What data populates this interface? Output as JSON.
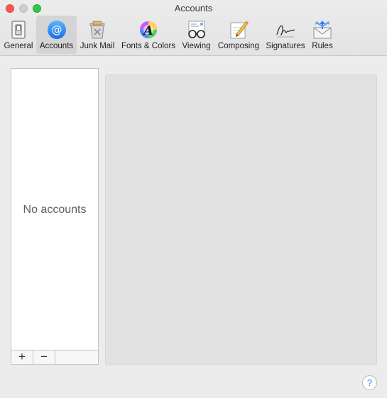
{
  "window": {
    "title": "Accounts"
  },
  "toolbar": {
    "items": [
      {
        "label": "General",
        "icon": "general-switch-icon",
        "selected": false
      },
      {
        "label": "Accounts",
        "icon": "at-sign-icon",
        "selected": true
      },
      {
        "label": "Junk Mail",
        "icon": "junk-mail-trash-icon",
        "selected": false
      },
      {
        "label": "Fonts & Colors",
        "icon": "fonts-colors-icon",
        "selected": false
      },
      {
        "label": "Viewing",
        "icon": "viewing-glasses-icon",
        "selected": false
      },
      {
        "label": "Composing",
        "icon": "composing-pencil-icon",
        "selected": false
      },
      {
        "label": "Signatures",
        "icon": "signature-icon",
        "selected": false
      },
      {
        "label": "Rules",
        "icon": "rules-envelope-icon",
        "selected": false
      }
    ]
  },
  "accounts_list": {
    "empty_text": "No accounts",
    "add_label": "+",
    "remove_label": "−"
  },
  "help": {
    "label": "?"
  },
  "colors": {
    "close": "#fc5753",
    "minimize_disabled": "#cfcfcf",
    "zoom": "#33c748",
    "accent": "#2f7cf6",
    "selected_tab_bg": "#d4d4d4"
  }
}
